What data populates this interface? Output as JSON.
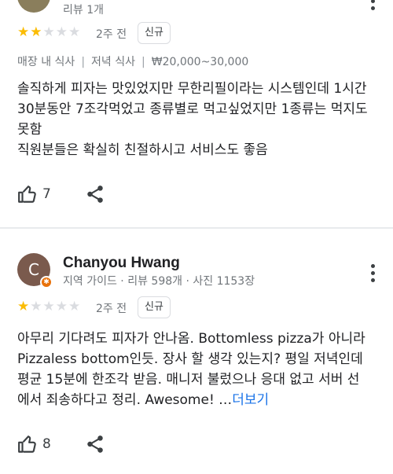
{
  "review1": {
    "meta": "리뷰 1개",
    "rating": 2,
    "max_rating": 5,
    "time": "2주 전",
    "chip": "신규",
    "tags": [
      "매장 내 식사",
      "저녁 식사",
      "₩20,000~30,000"
    ],
    "text_lines": [
      "솔직하게 피자는 맛있었지만 무한리필이라는 시스템인데 1시간",
      "30분동안 7조각먹었고 종류별로 먹고싶었지만 1종류는 먹지도",
      "못함",
      "직원분들은 확실히 친절하시고 서비스도 좋음"
    ],
    "likes": "7"
  },
  "review2": {
    "avatar_letter": "C",
    "name": "Chanyou Hwang",
    "meta": "지역 가이드 · 리뷰 598개 · 사진 1153장",
    "rating": 1,
    "max_rating": 5,
    "time": "2주 전",
    "chip": "신규",
    "text_lines": [
      "아무리 기다려도 피자가 안나옴. Bottomless pizza가 아니라",
      "Pizzaless bottom인듯. 장사 할 생각 있는지? 평일 저녁인데",
      "평균 15분에 한조각 받음. 매니저 불렀으나 응대 없고 서버 선",
      "에서 죄송하다고 정리. Awesome! …"
    ],
    "more_label": "더보기",
    "likes": "8"
  },
  "colors": {
    "star_on": "#fbbc04",
    "star_off": "#dadce0",
    "link": "#1a73e8",
    "avatar_badge": "#e8710a"
  },
  "icons": [
    "thumbs-up-icon",
    "share-icon",
    "more-vert-icon",
    "local-guide-badge-icon",
    "star-icon"
  ]
}
